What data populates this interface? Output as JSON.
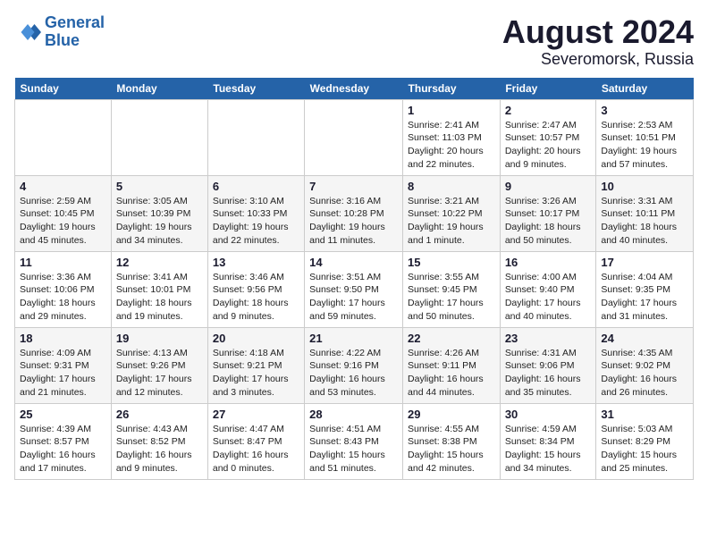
{
  "header": {
    "logo_line1": "General",
    "logo_line2": "Blue",
    "title": "August 2024",
    "subtitle": "Severomorsk, Russia"
  },
  "weekdays": [
    "Sunday",
    "Monday",
    "Tuesday",
    "Wednesday",
    "Thursday",
    "Friday",
    "Saturday"
  ],
  "weeks": [
    [
      {
        "day": "",
        "info": ""
      },
      {
        "day": "",
        "info": ""
      },
      {
        "day": "",
        "info": ""
      },
      {
        "day": "",
        "info": ""
      },
      {
        "day": "1",
        "info": "Sunrise: 2:41 AM\nSunset: 11:03 PM\nDaylight: 20 hours\nand 22 minutes."
      },
      {
        "day": "2",
        "info": "Sunrise: 2:47 AM\nSunset: 10:57 PM\nDaylight: 20 hours\nand 9 minutes."
      },
      {
        "day": "3",
        "info": "Sunrise: 2:53 AM\nSunset: 10:51 PM\nDaylight: 19 hours\nand 57 minutes."
      }
    ],
    [
      {
        "day": "4",
        "info": "Sunrise: 2:59 AM\nSunset: 10:45 PM\nDaylight: 19 hours\nand 45 minutes."
      },
      {
        "day": "5",
        "info": "Sunrise: 3:05 AM\nSunset: 10:39 PM\nDaylight: 19 hours\nand 34 minutes."
      },
      {
        "day": "6",
        "info": "Sunrise: 3:10 AM\nSunset: 10:33 PM\nDaylight: 19 hours\nand 22 minutes."
      },
      {
        "day": "7",
        "info": "Sunrise: 3:16 AM\nSunset: 10:28 PM\nDaylight: 19 hours\nand 11 minutes."
      },
      {
        "day": "8",
        "info": "Sunrise: 3:21 AM\nSunset: 10:22 PM\nDaylight: 19 hours\nand 1 minute."
      },
      {
        "day": "9",
        "info": "Sunrise: 3:26 AM\nSunset: 10:17 PM\nDaylight: 18 hours\nand 50 minutes."
      },
      {
        "day": "10",
        "info": "Sunrise: 3:31 AM\nSunset: 10:11 PM\nDaylight: 18 hours\nand 40 minutes."
      }
    ],
    [
      {
        "day": "11",
        "info": "Sunrise: 3:36 AM\nSunset: 10:06 PM\nDaylight: 18 hours\nand 29 minutes."
      },
      {
        "day": "12",
        "info": "Sunrise: 3:41 AM\nSunset: 10:01 PM\nDaylight: 18 hours\nand 19 minutes."
      },
      {
        "day": "13",
        "info": "Sunrise: 3:46 AM\nSunset: 9:56 PM\nDaylight: 18 hours\nand 9 minutes."
      },
      {
        "day": "14",
        "info": "Sunrise: 3:51 AM\nSunset: 9:50 PM\nDaylight: 17 hours\nand 59 minutes."
      },
      {
        "day": "15",
        "info": "Sunrise: 3:55 AM\nSunset: 9:45 PM\nDaylight: 17 hours\nand 50 minutes."
      },
      {
        "day": "16",
        "info": "Sunrise: 4:00 AM\nSunset: 9:40 PM\nDaylight: 17 hours\nand 40 minutes."
      },
      {
        "day": "17",
        "info": "Sunrise: 4:04 AM\nSunset: 9:35 PM\nDaylight: 17 hours\nand 31 minutes."
      }
    ],
    [
      {
        "day": "18",
        "info": "Sunrise: 4:09 AM\nSunset: 9:31 PM\nDaylight: 17 hours\nand 21 minutes."
      },
      {
        "day": "19",
        "info": "Sunrise: 4:13 AM\nSunset: 9:26 PM\nDaylight: 17 hours\nand 12 minutes."
      },
      {
        "day": "20",
        "info": "Sunrise: 4:18 AM\nSunset: 9:21 PM\nDaylight: 17 hours\nand 3 minutes."
      },
      {
        "day": "21",
        "info": "Sunrise: 4:22 AM\nSunset: 9:16 PM\nDaylight: 16 hours\nand 53 minutes."
      },
      {
        "day": "22",
        "info": "Sunrise: 4:26 AM\nSunset: 9:11 PM\nDaylight: 16 hours\nand 44 minutes."
      },
      {
        "day": "23",
        "info": "Sunrise: 4:31 AM\nSunset: 9:06 PM\nDaylight: 16 hours\nand 35 minutes."
      },
      {
        "day": "24",
        "info": "Sunrise: 4:35 AM\nSunset: 9:02 PM\nDaylight: 16 hours\nand 26 minutes."
      }
    ],
    [
      {
        "day": "25",
        "info": "Sunrise: 4:39 AM\nSunset: 8:57 PM\nDaylight: 16 hours\nand 17 minutes."
      },
      {
        "day": "26",
        "info": "Sunrise: 4:43 AM\nSunset: 8:52 PM\nDaylight: 16 hours\nand 9 minutes."
      },
      {
        "day": "27",
        "info": "Sunrise: 4:47 AM\nSunset: 8:47 PM\nDaylight: 16 hours\nand 0 minutes."
      },
      {
        "day": "28",
        "info": "Sunrise: 4:51 AM\nSunset: 8:43 PM\nDaylight: 15 hours\nand 51 minutes."
      },
      {
        "day": "29",
        "info": "Sunrise: 4:55 AM\nSunset: 8:38 PM\nDaylight: 15 hours\nand 42 minutes."
      },
      {
        "day": "30",
        "info": "Sunrise: 4:59 AM\nSunset: 8:34 PM\nDaylight: 15 hours\nand 34 minutes."
      },
      {
        "day": "31",
        "info": "Sunrise: 5:03 AM\nSunset: 8:29 PM\nDaylight: 15 hours\nand 25 minutes."
      }
    ]
  ]
}
